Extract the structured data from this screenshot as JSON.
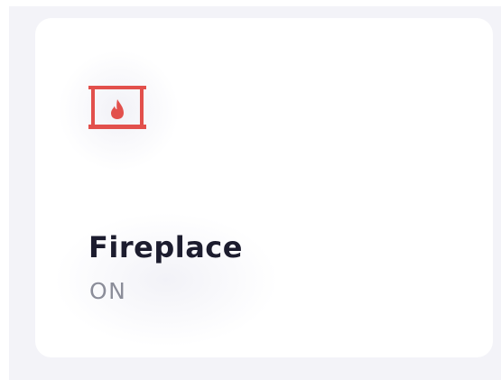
{
  "device": {
    "name": "Fireplace",
    "state": "ON",
    "icon": "fireplace-icon",
    "accent_color": "#e2504c"
  },
  "colors": {
    "background": "#f3f3f8",
    "card": "#ffffff",
    "title": "#1c1c2e",
    "status": "#8b8d99"
  }
}
